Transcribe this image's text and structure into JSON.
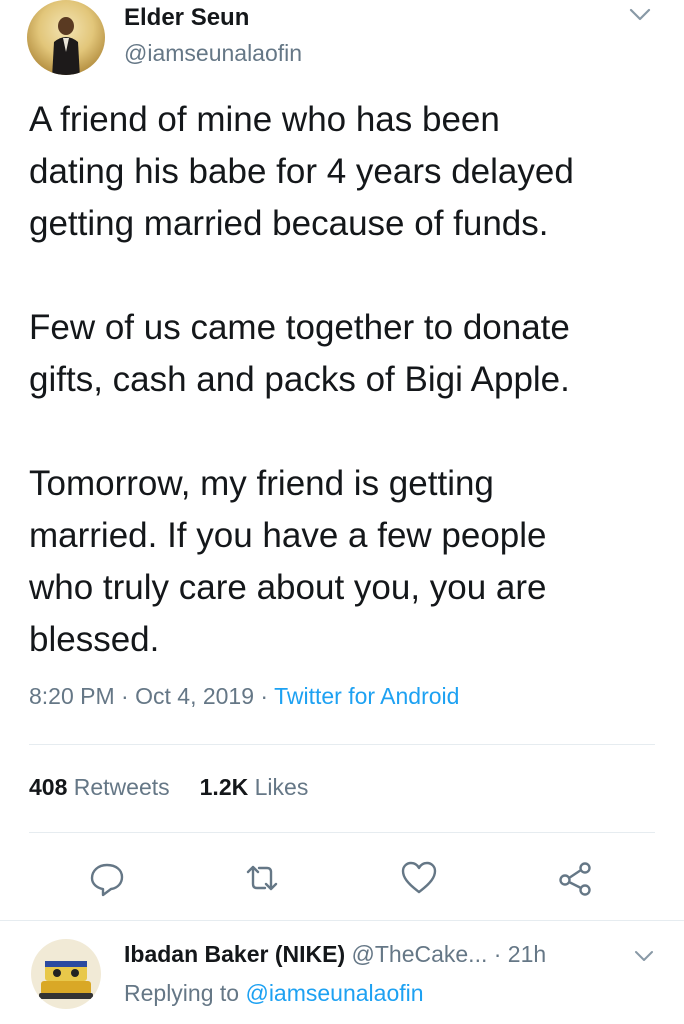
{
  "tweet": {
    "author": {
      "name": "Elder Seun",
      "handle": "@iamseunalaofin"
    },
    "paragraphs": [
      [
        "A friend of mine who has been",
        "dating his babe for 4 years delayed",
        "getting married because of funds."
      ],
      [
        "Few of us came together to donate",
        "gifts, cash and packs of Bigi Apple."
      ],
      [
        "Tomorrow, my friend is getting",
        "married. If you have a few people",
        "who truly care about you, you are",
        "blessed."
      ]
    ],
    "time": "8:20 PM",
    "date": "Oct 4, 2019",
    "separator": "·",
    "source": "Twitter for Android",
    "retweets_count": "408",
    "retweets_label": "Retweets",
    "likes_count": "1.2K",
    "likes_label": "Likes",
    "actions": [
      "reply-icon",
      "retweet-icon",
      "like-icon",
      "share-icon"
    ]
  },
  "reply": {
    "name": "Ibadan Baker (NIKE)",
    "handle": "@TheCake...",
    "separator": "·",
    "age": "21h",
    "replying_prefix": "Replying to",
    "replying_to": "@iamseunalaofin"
  },
  "colors": {
    "text": "#14171a",
    "secondary": "#657786",
    "accent": "#1da1f2",
    "divider": "#e6ecf0"
  }
}
